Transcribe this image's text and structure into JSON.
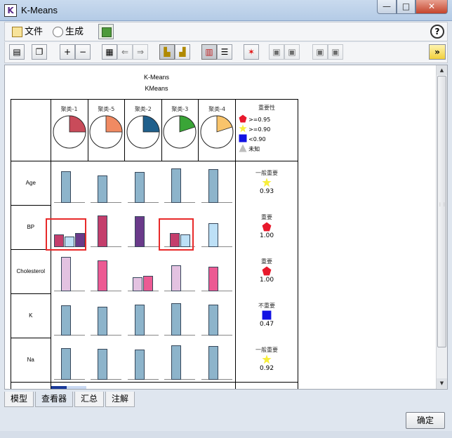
{
  "window": {
    "title": "K-Means",
    "app_icon_letter": "K",
    "min": "—",
    "max": "□",
    "close": "✕"
  },
  "menu": {
    "file": "文件",
    "generate": "生成",
    "help": "?"
  },
  "toolbar": {
    "zoom_in": "+",
    "zoom_out": "−",
    "back": "⇐",
    "forward": "⇒",
    "star": "✶",
    "expand": "»"
  },
  "report": {
    "title": "K-Means",
    "subtitle": "KMeans"
  },
  "clusters": [
    {
      "name": "聚类-1",
      "share": 0.25,
      "color": "#c94b5a"
    },
    {
      "name": "聚类-5",
      "share": 0.25,
      "color": "#f08a62"
    },
    {
      "name": "聚类-2",
      "share": 0.25,
      "color": "#1f5f8b"
    },
    {
      "name": "聚类-3",
      "share": 0.2,
      "color": "#3aa537"
    },
    {
      "name": "聚类-4",
      "share": 0.2,
      "color": "#f9c46b"
    }
  ],
  "importance_legend": {
    "header": "重要性",
    "items": [
      {
        "label": ">=0.95",
        "symbol": "pentagon",
        "color": "#e8192c"
      },
      {
        "label": ">=0.90",
        "symbol": "star",
        "color": "#f7ee3a"
      },
      {
        "label": "<0.90",
        "symbol": "square",
        "color": "#1212e3"
      },
      {
        "label": "未知",
        "symbol": "triangle",
        "color": "#bdbdbd"
      }
    ]
  },
  "fields": [
    {
      "name": "Age",
      "importance_label": "一般重要",
      "importance_symbol": "star",
      "importance_color": "#f7ee3a",
      "importance_value": "0.93",
      "bars": [
        [
          {
            "v": 0.8,
            "c": "#8db4cb"
          }
        ],
        [
          {
            "v": 0.7,
            "c": "#8db4cb"
          }
        ],
        [
          {
            "v": 0.78,
            "c": "#8db4cb"
          }
        ],
        [
          {
            "v": 0.88,
            "c": "#8db4cb"
          }
        ],
        [
          {
            "v": 0.85,
            "c": "#8db4cb"
          }
        ]
      ]
    },
    {
      "name": "BP",
      "importance_label": "重要",
      "importance_symbol": "pentagon",
      "importance_color": "#e8192c",
      "importance_value": "1.00",
      "bars": [
        [
          {
            "v": 0.33,
            "c": "#c43e6c"
          },
          {
            "v": 0.26,
            "c": "#bde0f6"
          },
          {
            "v": 0.35,
            "c": "#6a3a8a"
          }
        ],
        [
          {
            "v": 0.8,
            "c": "#c43e6c"
          }
        ],
        [
          {
            "v": 0.78,
            "c": "#6a3a8a"
          }
        ],
        [
          {
            "v": 0.35,
            "c": "#c43e6c"
          },
          {
            "v": 0.32,
            "c": "#bde0f6"
          }
        ],
        [
          {
            "v": 0.6,
            "c": "#bde0f6"
          }
        ]
      ]
    },
    {
      "name": "Cholesterol",
      "importance_label": "重要",
      "importance_symbol": "pentagon",
      "importance_color": "#e8192c",
      "importance_value": "1.00",
      "bars": [
        [
          {
            "v": 0.88,
            "c": "#e3c2e1"
          }
        ],
        [
          {
            "v": 0.78,
            "c": "#ec5a93"
          }
        ],
        [
          {
            "v": 0.35,
            "c": "#e3c2e1"
          },
          {
            "v": 0.4,
            "c": "#ec5a93"
          }
        ],
        [
          {
            "v": 0.66,
            "c": "#e3c2e1"
          }
        ],
        [
          {
            "v": 0.62,
            "c": "#ec5a93"
          }
        ]
      ]
    },
    {
      "name": "K",
      "importance_label": "不重要",
      "importance_symbol": "square",
      "importance_color": "#1212e3",
      "importance_value": "0.47",
      "bars": [
        [
          {
            "v": 0.76,
            "c": "#8db4cb"
          }
        ],
        [
          {
            "v": 0.73,
            "c": "#8db4cb"
          }
        ],
        [
          {
            "v": 0.79,
            "c": "#8db4cb"
          }
        ],
        [
          {
            "v": 0.83,
            "c": "#8db4cb"
          }
        ],
        [
          {
            "v": 0.79,
            "c": "#8db4cb"
          }
        ]
      ]
    },
    {
      "name": "Na",
      "importance_label": "一般重要",
      "importance_symbol": "star",
      "importance_color": "#f7ee3a",
      "importance_value": "0.92",
      "bars": [
        [
          {
            "v": 0.8,
            "c": "#8db4cb"
          }
        ],
        [
          {
            "v": 0.78,
            "c": "#8db4cb"
          }
        ],
        [
          {
            "v": 0.76,
            "c": "#8db4cb"
          }
        ],
        [
          {
            "v": 0.88,
            "c": "#8db4cb"
          }
        ],
        [
          {
            "v": 0.85,
            "c": "#8db4cb"
          }
        ]
      ]
    }
  ],
  "tabs": [
    "模型",
    "查看器",
    "汇总",
    "注解"
  ],
  "active_tab": 1,
  "ok_button": "确定"
}
